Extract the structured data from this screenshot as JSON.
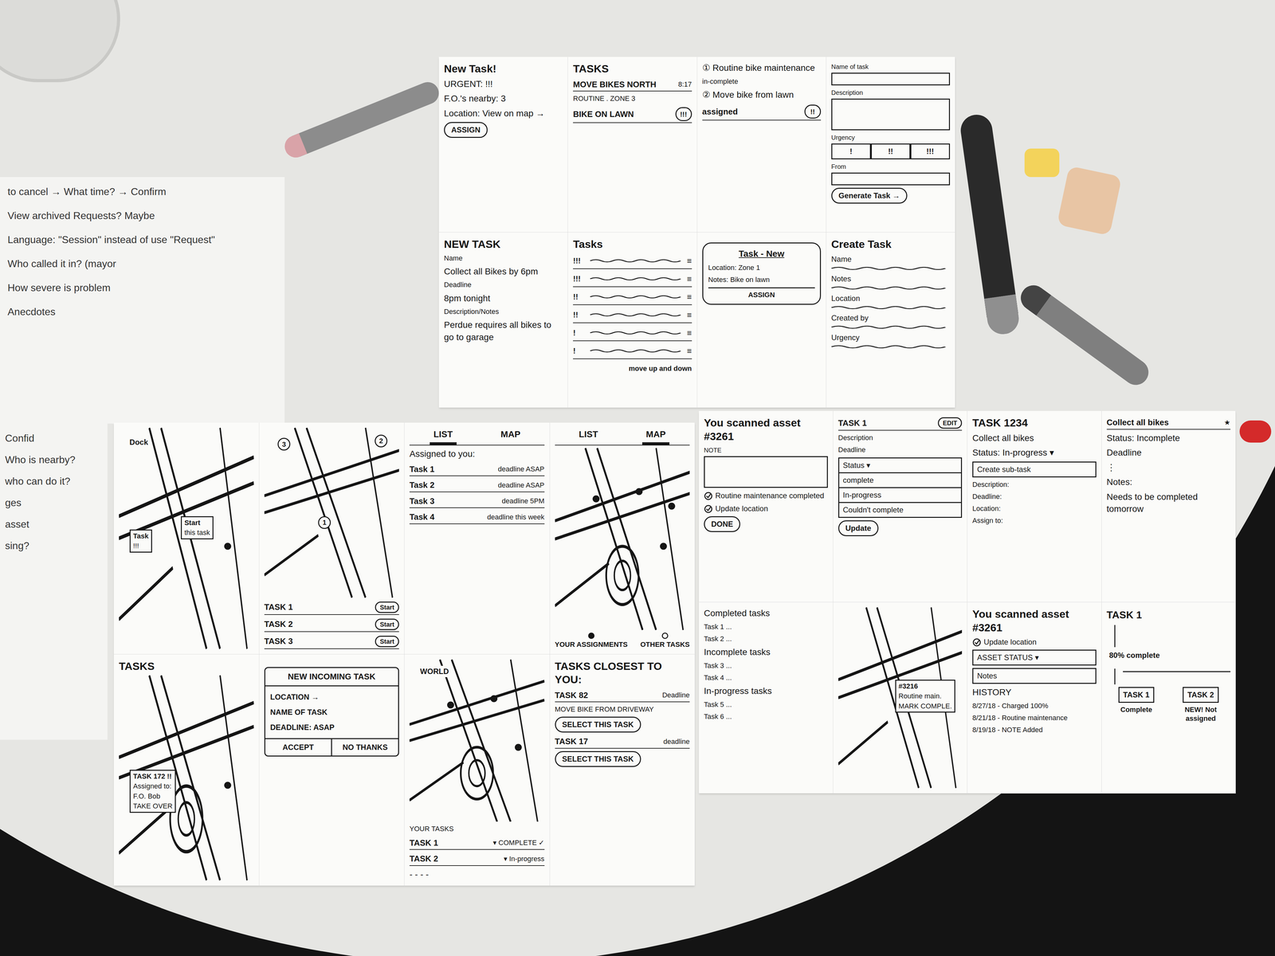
{
  "notes": {
    "top": [
      "to cancel → What time? → Confirm",
      "View archived Requests? Maybe",
      "Language: \"Session\" instead of use \"Request\"",
      "Who called it in? (mayor",
      "How severe is problem",
      "Anecdotes"
    ],
    "side": [
      "Confid",
      "Who is nearby?",
      "who can do it?",
      "ges",
      "asset",
      "sing?"
    ]
  },
  "sheets": [
    {
      "panels": [
        {
          "items": [
            {
              "kind": "title",
              "text": "New Task!"
            },
            {
              "kind": "text",
              "text": "URGENT: !!!"
            },
            {
              "kind": "text",
              "text": "F.O.'s nearby: 3"
            },
            {
              "kind": "text",
              "text": "Location: View on map →"
            },
            {
              "kind": "button",
              "text": "ASSIGN"
            }
          ]
        },
        {
          "items": [
            {
              "kind": "title",
              "text": "TASKS"
            },
            {
              "kind": "row",
              "text": "MOVE BIKES NORTH",
              "right": "8:17"
            },
            {
              "kind": "small",
              "text": "ROUTINE . ZONE 3"
            },
            {
              "kind": "row",
              "text": "BIKE ON LAWN",
              "badge": "!!!"
            }
          ]
        },
        {
          "items": [
            {
              "kind": "text",
              "text": "① Routine bike maintenance"
            },
            {
              "kind": "small",
              "text": "in-complete"
            },
            {
              "kind": "text",
              "text": "② Move bike from lawn"
            },
            {
              "kind": "row",
              "text": "assigned",
              "badge": "!!"
            }
          ]
        },
        {
          "items": [
            {
              "kind": "field",
              "text": "Name of task"
            },
            {
              "kind": "area",
              "text": "Description"
            },
            {
              "kind": "choices",
              "text": "Urgency",
              "options": [
                "!",
                "!!",
                "!!!"
              ]
            },
            {
              "kind": "field",
              "text": "From"
            },
            {
              "kind": "button",
              "text": "Generate Task →"
            }
          ]
        },
        {
          "items": [
            {
              "kind": "title",
              "text": "NEW TASK"
            },
            {
              "kind": "small",
              "text": "Name"
            },
            {
              "kind": "text",
              "text": "Collect all Bikes by 6pm"
            },
            {
              "kind": "small",
              "text": "Deadline"
            },
            {
              "kind": "text",
              "text": "8pm tonight"
            },
            {
              "kind": "small",
              "text": "Description/Notes"
            },
            {
              "kind": "text",
              "text": "Perdue requires all bikes to go to garage"
            }
          ]
        },
        {
          "items": [
            {
              "kind": "title",
              "text": "Tasks"
            },
            {
              "kind": "wavy",
              "text": "!!!",
              "handle": "≡"
            },
            {
              "kind": "wavy",
              "text": "!!!",
              "handle": "≡"
            },
            {
              "kind": "wavy",
              "text": "!!",
              "handle": "≡"
            },
            {
              "kind": "wavy",
              "text": "!!",
              "handle": "≡"
            },
            {
              "kind": "wavy",
              "text": "!",
              "handle": "≡"
            },
            {
              "kind": "wavy",
              "text": "!",
              "handle": "≡"
            },
            {
              "kind": "note",
              "text": "move up and down"
            }
          ]
        },
        {
          "items": [
            {
              "kind": "card",
              "title": "Task - New",
              "lines": [
                "Location: Zone 1",
                "Notes: Bike on lawn"
              ],
              "button": "ASSIGN"
            }
          ]
        },
        {
          "items": [
            {
              "kind": "title",
              "text": "Create Task"
            },
            {
              "kind": "line",
              "text": "Name"
            },
            {
              "kind": "line",
              "text": "Notes"
            },
            {
              "kind": "line",
              "text": "Location"
            },
            {
              "kind": "line",
              "text": "Created by"
            },
            {
              "kind": "line",
              "text": "Urgency"
            }
          ]
        }
      ]
    },
    {
      "panels": [
        {
          "items": [
            {
              "kind": "map",
              "tag": "Dock",
              "pins": [],
              "dots": 1,
              "cards": [
                [
                  "Task",
                  "!!!"
                ],
                [
                  "Start",
                  "this task"
                ]
              ]
            }
          ]
        },
        {
          "items": [
            {
              "kind": "map",
              "pins": [
                "3",
                "2",
                "1"
              ],
              "dots": 0,
              "cards": []
            },
            {
              "kind": "row",
              "text": "TASK 1",
              "pill": "Start"
            },
            {
              "kind": "row",
              "text": "TASK 2",
              "pill": "Start"
            },
            {
              "kind": "row",
              "text": "TASK 3",
              "pill": "Start"
            }
          ]
        },
        {
          "items": [
            {
              "kind": "tabs",
              "tabs": [
                {
                  "label": "LIST",
                  "selected": true
                },
                {
                  "label": "MAP",
                  "selected": false
                }
              ]
            },
            {
              "kind": "text",
              "text": "Assigned to you:"
            },
            {
              "kind": "row",
              "text": "Task 1",
              "right": "deadline ASAP"
            },
            {
              "kind": "row",
              "text": "Task 2",
              "right": "deadline ASAP"
            },
            {
              "kind": "row",
              "text": "Task 3",
              "right": "deadline 5PM"
            },
            {
              "kind": "row",
              "text": "Task 4",
              "right": "deadline this week"
            }
          ]
        },
        {
          "items": [
            {
              "kind": "tabs",
              "tabs": [
                {
                  "label": "LIST",
                  "selected": false
                },
                {
                  "label": "MAP",
                  "selected": true
                }
              ]
            },
            {
              "kind": "round-map",
              "pins": [],
              "dots": 4,
              "cards": []
            },
            {
              "kind": "legend",
              "items": [
                {
                  "label": "YOUR ASSIGNMENTS",
                  "filled": true
                },
                {
                  "label": "OTHER TASKS",
                  "filled": false
                }
              ]
            }
          ]
        },
        {
          "items": [
            {
              "kind": "title",
              "text": "TASKS"
            },
            {
              "kind": "round-map",
              "pins": [],
              "dots": 1,
              "cards": [
                [
                  "TASK 172 !!",
                  "Assigned to:",
                  "F.O. Bob",
                  "TAKE OVER"
                ]
              ]
            }
          ]
        },
        {
          "items": [
            {
              "kind": "dialog",
              "title": "NEW INCOMING TASK",
              "lines": [
                "LOCATION →",
                "NAME OF TASK",
                "DEADLINE: ASAP"
              ],
              "buttons": [
                "ACCEPT",
                "NO THANKS"
              ]
            }
          ]
        },
        {
          "items": [
            {
              "kind": "round-map",
              "tag": "WORLD",
              "pins": [],
              "dots": 3,
              "cards": []
            },
            {
              "kind": "small",
              "text": "YOUR TASKS"
            },
            {
              "kind": "row",
              "text": "TASK 1",
              "right": "▾ COMPLETE ✓"
            },
            {
              "kind": "row",
              "text": "TASK 2",
              "right": "▾ In-progress"
            },
            {
              "kind": "text",
              "text": "- - - -"
            }
          ]
        },
        {
          "items": [
            {
              "kind": "title",
              "text": "TASKS CLOSEST TO YOU:"
            },
            {
              "kind": "row",
              "text": "TASK 82",
              "right": "Deadline"
            },
            {
              "kind": "small",
              "text": "MOVE BIKE FROM DRIVEWAY"
            },
            {
              "kind": "button",
              "text": "SELECT THIS TASK"
            },
            {
              "kind": "row",
              "text": "TASK 17",
              "right": "deadline"
            },
            {
              "kind": "button",
              "text": "SELECT THIS TASK"
            }
          ]
        }
      ]
    },
    {
      "panels": [
        {
          "items": [
            {
              "kind": "title",
              "text": "You scanned asset #3261"
            },
            {
              "kind": "area",
              "text": "NOTE"
            },
            {
              "kind": "check",
              "text": "Routine maintenance completed",
              "checked": true
            },
            {
              "kind": "check",
              "text": "Update location",
              "checked": true
            },
            {
              "kind": "button",
              "text": "DONE"
            }
          ]
        },
        {
          "items": [
            {
              "kind": "row",
              "text": "TASK 1",
              "pill": "EDIT"
            },
            {
              "kind": "small",
              "text": "Description"
            },
            {
              "kind": "small",
              "text": "Deadline"
            },
            {
              "kind": "options",
              "options": [
                "Status ▾",
                "complete",
                "In-progress",
                "Couldn't complete"
              ]
            },
            {
              "kind": "button",
              "text": "Update"
            }
          ]
        },
        {
          "items": [
            {
              "kind": "title",
              "text": "TASK 1234"
            },
            {
              "kind": "text",
              "text": "Collect all bikes"
            },
            {
              "kind": "text",
              "text": "Status: In-progress ▾"
            },
            {
              "kind": "box",
              "text": "Create sub-task"
            },
            {
              "kind": "small",
              "text": "Description:"
            },
            {
              "kind": "small",
              "text": "Deadline:"
            },
            {
              "kind": "small",
              "text": "Location:"
            },
            {
              "kind": "small",
              "text": "Assign to:"
            }
          ]
        },
        {
          "items": [
            {
              "kind": "row",
              "text": "Collect all bikes",
              "right": "★"
            },
            {
              "kind": "text",
              "text": "Status: Incomplete"
            },
            {
              "kind": "text",
              "text": "Deadline"
            },
            {
              "kind": "text",
              "text": "⋮"
            },
            {
              "kind": "text",
              "text": "Notes:"
            },
            {
              "kind": "text",
              "text": "Needs to be completed tomorrow"
            }
          ]
        },
        {
          "items": [
            {
              "kind": "text",
              "text": "Completed tasks"
            },
            {
              "kind": "small",
              "text": "Task 1 ..."
            },
            {
              "kind": "small",
              "text": "Task 2 ..."
            },
            {
              "kind": "text",
              "text": "Incomplete tasks"
            },
            {
              "kind": "small",
              "text": "Task 3 ..."
            },
            {
              "kind": "small",
              "text": "Task 4 ..."
            },
            {
              "kind": "text",
              "text": "In-progress tasks"
            },
            {
              "kind": "small",
              "text": "Task 5 ..."
            },
            {
              "kind": "small",
              "text": "Task 6 ..."
            }
          ]
        },
        {
          "items": [
            {
              "kind": "map",
              "pins": [],
              "dots": 0,
              "cards": [
                [],
                [
                  "#3216",
                  "Routine main.",
                  "MARK COMPLE."
                ]
              ]
            }
          ]
        },
        {
          "items": [
            {
              "kind": "title",
              "text": "You scanned asset #3261"
            },
            {
              "kind": "check",
              "text": "Update location",
              "checked": true
            },
            {
              "kind": "box",
              "text": "ASSET STATUS ▾"
            },
            {
              "kind": "box",
              "text": "Notes"
            },
            {
              "kind": "text",
              "text": "HISTORY"
            },
            {
              "kind": "small",
              "text": "8/27/18 - Charged 100%"
            },
            {
              "kind": "small",
              "text": "8/21/18 - Routine maintenance"
            },
            {
              "kind": "small",
              "text": "8/19/18 - NOTE Added"
            }
          ]
        },
        {
          "items": [
            {
              "kind": "tree",
              "title": "TASK 1",
              "caption": "80% complete",
              "children": [
                {
                  "title": "TASK 1",
                  "note": "Complete"
                },
                {
                  "title": "TASK 2",
                  "note": "NEW! Not assigned"
                }
              ]
            }
          ]
        }
      ]
    }
  ]
}
